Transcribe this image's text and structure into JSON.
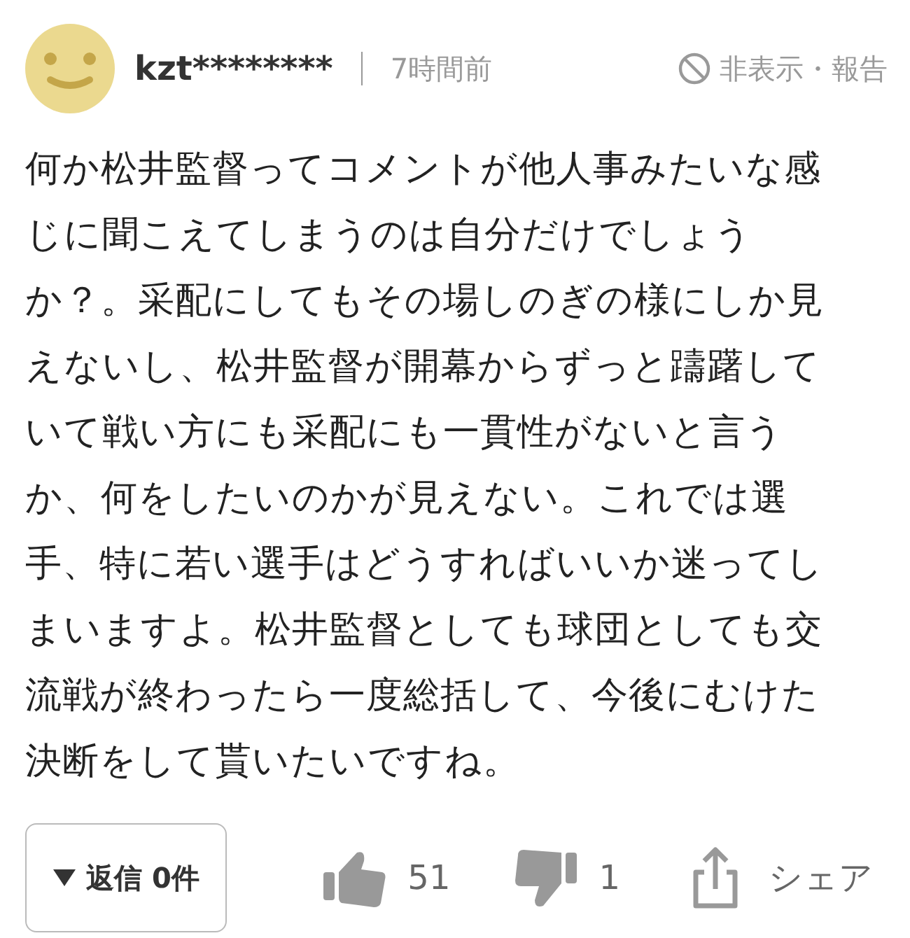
{
  "comment": {
    "user": "kzt********",
    "time": "7時間前",
    "hide_report": "非表示・報告",
    "body": "何か松井監督ってコメントが他人事みたいな感じに聞こえてしまうのは自分だけでしょうか？。采配にしてもその場しのぎの様にしか見えないし、松井監督が開幕からずっと躊躇していて戦い方にも采配にも一貫性がないと言うか、何をしたいのかが見えない。これでは選手、特に若い選手はどうすればいいか迷ってしまいますよ。松井監督としても球団としても交流戦が終わったら一度総括して、今後にむけた決断をして貰いたいですね。",
    "replies": "返信 0件",
    "likes": "51",
    "dislikes": "1",
    "share": "シェア"
  }
}
